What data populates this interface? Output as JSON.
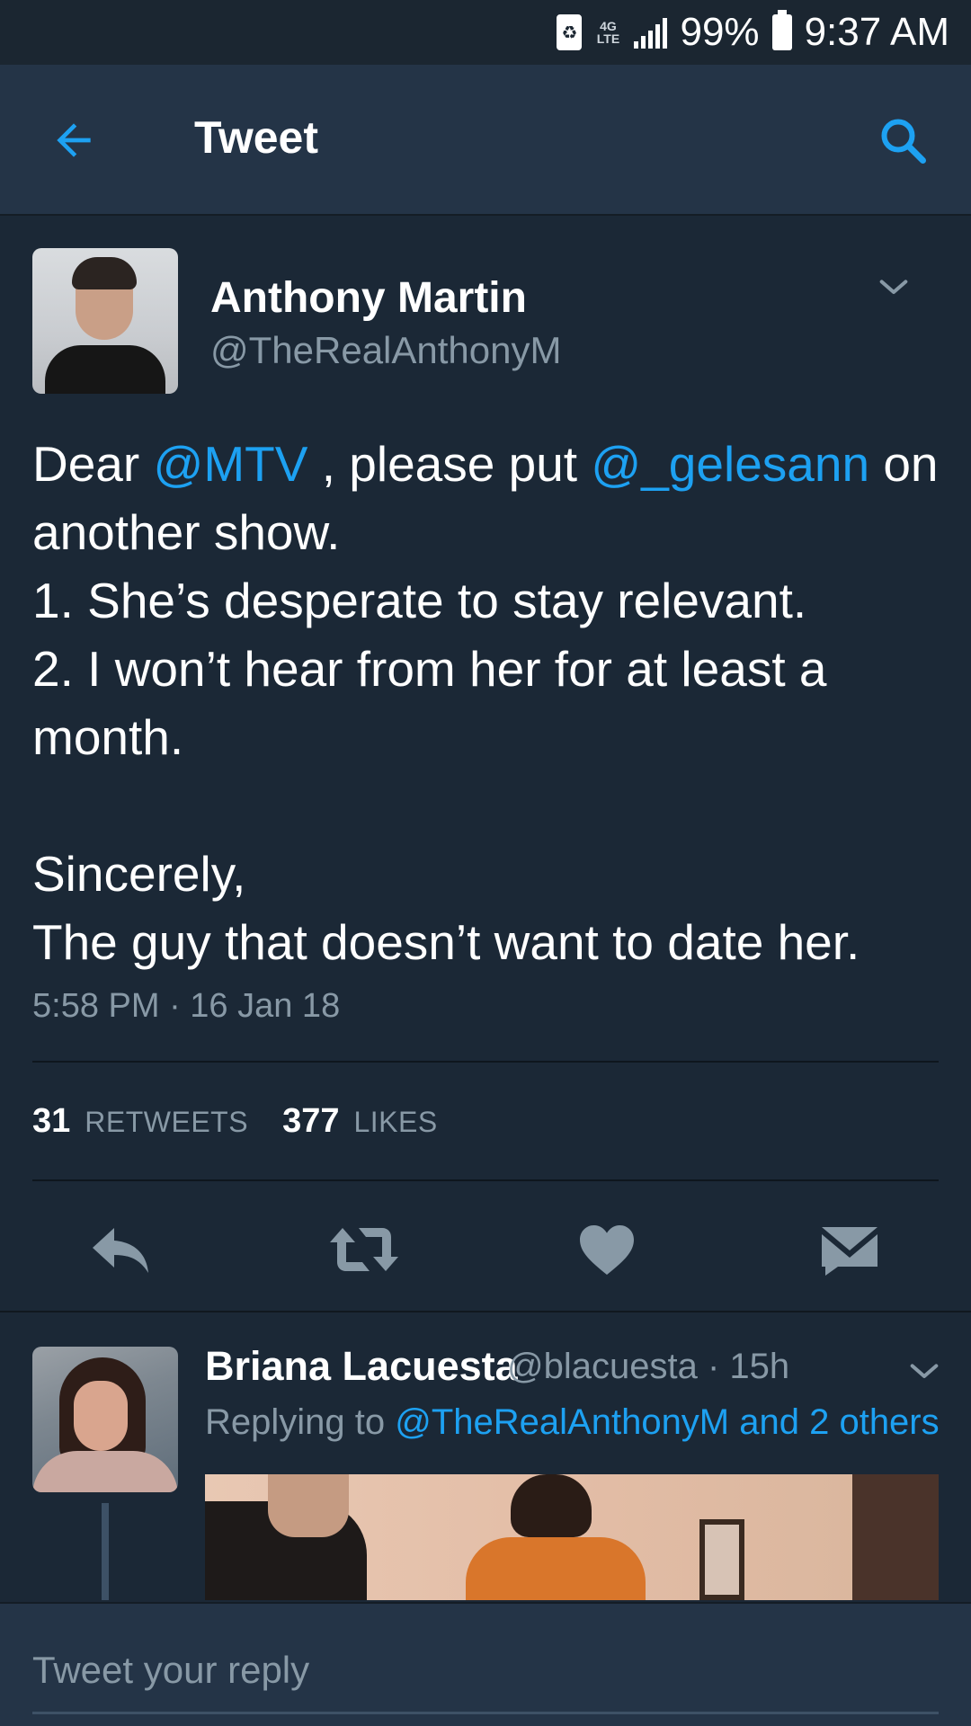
{
  "status_bar": {
    "battery_percent": "99%",
    "time": "9:37 AM",
    "network": "4G LTE"
  },
  "header": {
    "title": "Tweet",
    "back_icon": "arrow-left-icon",
    "search_icon": "search-icon"
  },
  "tweet": {
    "author_name": "Anthony Martin",
    "author_handle": "@TheRealAnthonyM",
    "text_parts": {
      "p1": "Dear ",
      "m1": "@MTV",
      "p2": " , please put ",
      "m2": "@_gelesann",
      "p3": " on another show.\n1. She’s desperate to stay relevant.\n2. I won’t hear from her for at least a month.\n\nSincerely,\nThe guy that doesn’t want to date her."
    },
    "timestamp": "5:58 PM · 16 Jan 18",
    "retweets_count": "31",
    "retweets_label": "RETWEETS",
    "likes_count": "377",
    "likes_label": "LIKES"
  },
  "reply": {
    "author_name": "Briana Lacuesta",
    "meta": "@blacuesta · 15h",
    "replying_prefix": "Replying to ",
    "replying_to": "@TheRealAnthonyM and 2 others"
  },
  "composer": {
    "placeholder": "Tweet your reply"
  },
  "colors": {
    "accent": "#1da1f2",
    "background": "#1b2836",
    "header": "#243447",
    "muted_text": "#8899a6"
  }
}
